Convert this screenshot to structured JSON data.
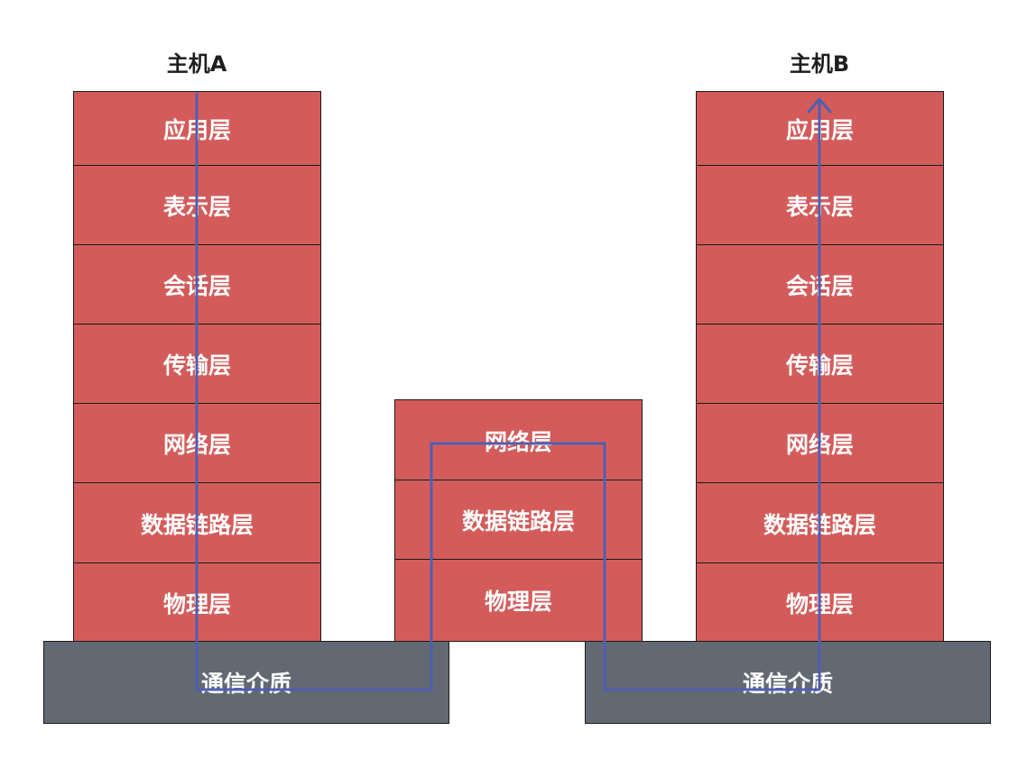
{
  "hostA": {
    "title": "主机A",
    "layers": [
      "应用层",
      "表示层",
      "会话层",
      "传输层",
      "网络层",
      "数据链路层",
      "物理层"
    ],
    "medium": "通信介质"
  },
  "router": {
    "layers": [
      "网络层",
      "数据链路层",
      "物理层"
    ]
  },
  "hostB": {
    "title": "主机B",
    "layers": [
      "应用层",
      "表示层",
      "会话层",
      "传输层",
      "网络层",
      "数据链路层",
      "物理层"
    ],
    "medium": "通信介质"
  },
  "colors": {
    "layer": "#d35c5b",
    "medium": "#636972",
    "path": "#4f5fb0"
  }
}
